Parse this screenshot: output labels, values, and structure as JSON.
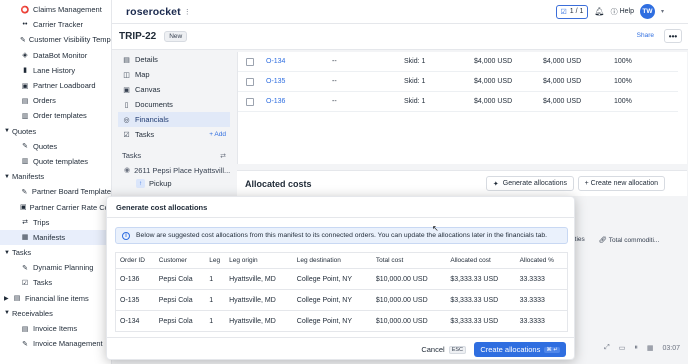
{
  "sidebar": {
    "items": [
      {
        "label": "Claims Management",
        "icon": "claims-icon",
        "glyph": "⭕",
        "level": 2
      },
      {
        "label": "Carrier Tracker",
        "icon": "tracker-icon",
        "glyph": "••",
        "level": 2
      },
      {
        "label": "Customer Visibility Temp...",
        "icon": "customer-visibility-icon",
        "glyph": "✎",
        "level": 2
      },
      {
        "label": "DataBot Monitor",
        "icon": "databot-icon",
        "glyph": "◈",
        "level": 2
      },
      {
        "label": "Lane History",
        "icon": "lane-history-icon",
        "glyph": "▮",
        "level": 2
      },
      {
        "label": "Partner Loadboard",
        "icon": "loadboard-icon",
        "glyph": "▣",
        "level": 2
      },
      {
        "label": "Orders",
        "icon": "orders-icon",
        "glyph": "▤",
        "level": 2
      },
      {
        "label": "Order templates",
        "icon": "order-templates-icon",
        "glyph": "▥",
        "level": 2
      },
      {
        "label": "Quotes",
        "icon": "quotes-section-icon",
        "glyph": "",
        "level": 1,
        "caret": "▼"
      },
      {
        "label": "Quotes",
        "icon": "quotes-icon",
        "glyph": "✎",
        "level": 2
      },
      {
        "label": "Quote templates",
        "icon": "quote-templates-icon",
        "glyph": "▥",
        "level": 2
      },
      {
        "label": "Manifests",
        "icon": "manifests-section-icon",
        "glyph": "",
        "level": 1,
        "caret": "▼"
      },
      {
        "label": "Partner Board Template",
        "icon": "partner-board-icon",
        "glyph": "✎",
        "level": 2
      },
      {
        "label": "Partner Carrier Rate Con",
        "icon": "rate-con-icon",
        "glyph": "▣",
        "level": 2
      },
      {
        "label": "Trips",
        "icon": "trips-icon",
        "glyph": "⇄",
        "level": 2
      },
      {
        "label": "Manifests",
        "icon": "manifests-icon",
        "glyph": "▦",
        "level": 2,
        "active": true
      },
      {
        "label": "Tasks",
        "icon": "tasks-section-icon",
        "glyph": "",
        "level": 1,
        "caret": "▼"
      },
      {
        "label": "Dynamic Planning",
        "icon": "dynamic-planning-icon",
        "glyph": "✎",
        "level": 2
      },
      {
        "label": "Tasks",
        "icon": "tasks-icon",
        "glyph": "☑",
        "level": 2
      },
      {
        "label": "Financial line items",
        "icon": "financial-line-items-icon",
        "glyph": "▤",
        "level": 1,
        "caret": "▶"
      },
      {
        "label": "Receivables",
        "icon": "receivables-section-icon",
        "glyph": "",
        "level": 1,
        "caret": "▼"
      },
      {
        "label": "Invoice Items",
        "icon": "invoice-items-icon",
        "glyph": "▤",
        "level": 2
      },
      {
        "label": "Invoice Management",
        "icon": "invoice-management-icon",
        "glyph": "✎",
        "level": 2
      }
    ]
  },
  "topbar": {
    "logo": "roserocket",
    "pager": "1 / 1",
    "help": "Help",
    "avatar": "TW"
  },
  "trip": {
    "title": "TRIP-22",
    "badge": "New",
    "share": "Share"
  },
  "subnav": {
    "items": [
      {
        "label": "Details",
        "icon": "details-icon",
        "glyph": "▤"
      },
      {
        "label": "Map",
        "icon": "map-icon",
        "glyph": "◫"
      },
      {
        "label": "Canvas",
        "icon": "canvas-icon",
        "glyph": "▣"
      },
      {
        "label": "Documents",
        "icon": "documents-icon",
        "glyph": "▯"
      },
      {
        "label": "Financials",
        "icon": "financials-icon",
        "glyph": "◎",
        "active": true
      },
      {
        "label": "Tasks",
        "icon": "tasks-icon",
        "glyph": "☑",
        "add": "+ Add"
      }
    ],
    "tasks_header": "Tasks",
    "stop": "2611 Pepsi Place Hyattsvill...",
    "pickup": "Pickup"
  },
  "orders": [
    {
      "id": "O-134",
      "dash": "--",
      "skid": "Skid: 1",
      "cost1": "$4,000 USD",
      "cost2": "$4,000 USD",
      "pct": "100%"
    },
    {
      "id": "O-135",
      "dash": "--",
      "skid": "Skid: 1",
      "cost1": "$4,000 USD",
      "cost2": "$4,000 USD",
      "pct": "100%"
    },
    {
      "id": "O-136",
      "dash": "--",
      "skid": "Skid: 1",
      "cost1": "$4,000 USD",
      "cost2": "$4,000 USD",
      "pct": "100%"
    }
  ],
  "allocated": {
    "title": "Allocated costs",
    "generate": "Generate allocations",
    "create": "+ Create new allocation",
    "col_commodities": "odities",
    "col_total_commodities": "Total commoditi..."
  },
  "bottom_bar": {
    "time": "03:07"
  },
  "modal": {
    "title": "Generate cost allocations",
    "info": "Below are suggested cost allocations from this manifest to its connected orders. You can update the allocations later in the financials tab.",
    "columns": [
      "Order ID",
      "Customer",
      "Leg",
      "Leg origin",
      "Leg destination",
      "Total cost",
      "Allocated cost",
      "Allocated %"
    ],
    "rows": [
      [
        "O-136",
        "Pepsi Cola",
        "1",
        "Hyattsville, MD",
        "College Point, NY",
        "$10,000.00 USD",
        "$3,333.33 USD",
        "33.3333"
      ],
      [
        "O-135",
        "Pepsi Cola",
        "1",
        "Hyattsville, MD",
        "College Point, NY",
        "$10,000.00 USD",
        "$3,333.33 USD",
        "33.3333"
      ],
      [
        "O-134",
        "Pepsi Cola",
        "1",
        "Hyattsville, MD",
        "College Point, NY",
        "$10,000.00 USD",
        "$3,333.33 USD",
        "33.3333"
      ]
    ],
    "cancel": "Cancel",
    "cancel_key": "ESC",
    "primary": "Create allocations",
    "primary_key": "⌘ ↵"
  }
}
